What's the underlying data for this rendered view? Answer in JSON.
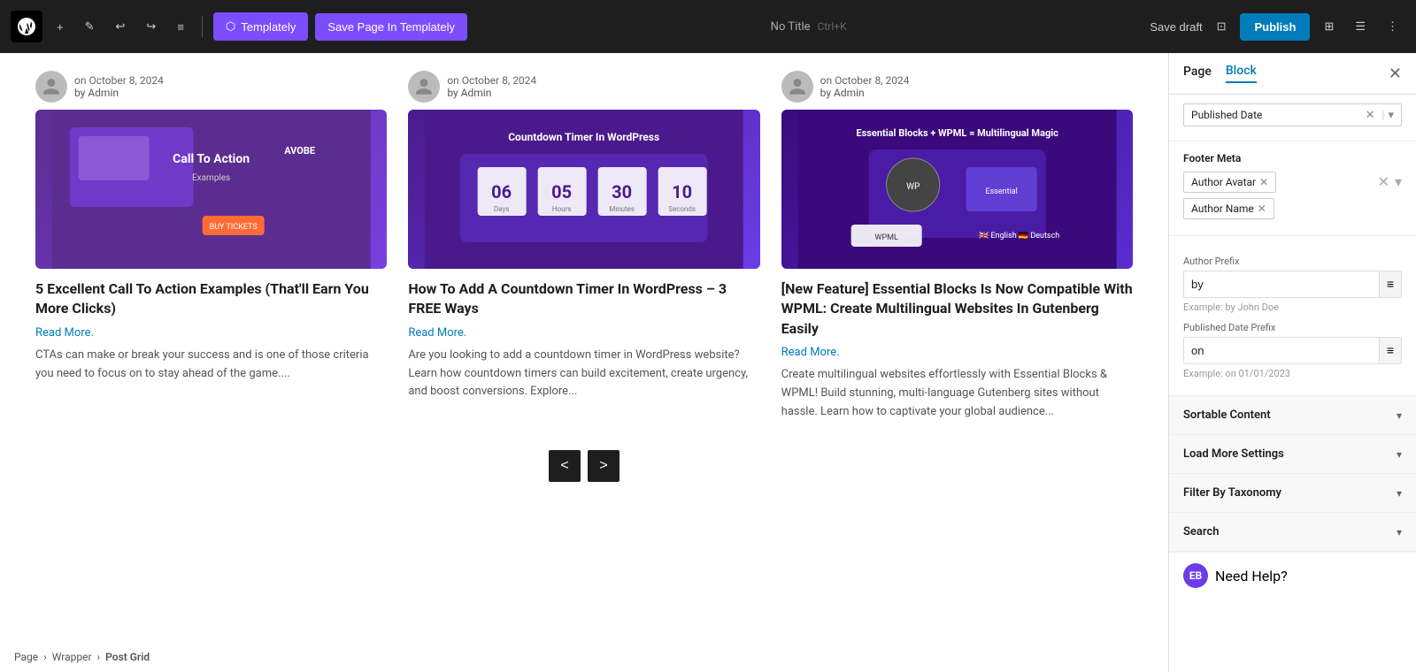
{
  "toolbar": {
    "add_label": "+",
    "pencil_label": "✎",
    "undo_label": "↩",
    "redo_label": "↪",
    "menu_label": "≡",
    "templately_label": "Templately",
    "save_page_label": "Save Page In Templately",
    "no_title": "No Title",
    "shortcut": "Ctrl+K",
    "save_draft_label": "Save draft",
    "publish_label": "Publish"
  },
  "panel": {
    "tab_page": "Page",
    "tab_block": "Block",
    "published_date_tag": "Published Date",
    "footer_meta_label": "Footer Meta",
    "author_avatar_tag": "Author Avatar",
    "author_name_tag": "Author Name",
    "author_prefix_label": "Author Prefix",
    "author_prefix_value": "by",
    "author_prefix_hint": "Example: by John Doe",
    "published_date_prefix_label": "Published Date Prefix",
    "published_date_prefix_value": "on",
    "published_date_prefix_hint": "Example: on 01/01/2023",
    "sortable_content_label": "Sortable Content",
    "load_more_settings_label": "Load More Settings",
    "filter_by_taxonomy_label": "Filter By Taxonomy",
    "search_label": "Search",
    "need_help_label": "Need Help?"
  },
  "posts": [
    {
      "date": "on October 8, 2024",
      "author": "by Admin",
      "image_type": "cta",
      "title": "5 Excellent Call To Action Examples (That'll Earn You More Clicks)",
      "read_more": "Read More.",
      "excerpt": "CTAs can make or break your success and is one of those criteria you need to focus on to stay ahead of the game...."
    },
    {
      "date": "on October 8, 2024",
      "author": "by Admin",
      "image_type": "countdown",
      "title": "How To Add A Countdown Timer In WordPress – 3 FREE Ways",
      "read_more": "Read More.",
      "excerpt": "Are you looking to add a countdown timer in WordPress website? Learn how countdown timers can build excitement, create urgency, and boost conversions. Explore..."
    },
    {
      "date": "on October 8, 2024",
      "author": "by Admin",
      "image_type": "wpml",
      "title": "[New Feature] Essential Blocks Is Now Compatible With WPML: Create Multilingual Websites In Gutenberg Easily",
      "read_more": "Read More.",
      "excerpt": "Create multilingual websites effortlessly with Essential Blocks & WPML! Build stunning, multi-language Gutenberg sites without hassle. Learn how to captivate your global audience..."
    }
  ],
  "pagination": {
    "prev": "<",
    "next": ">"
  },
  "breadcrumb": {
    "page": "Page",
    "wrapper": "Wrapper",
    "post_grid": "Post Grid"
  }
}
